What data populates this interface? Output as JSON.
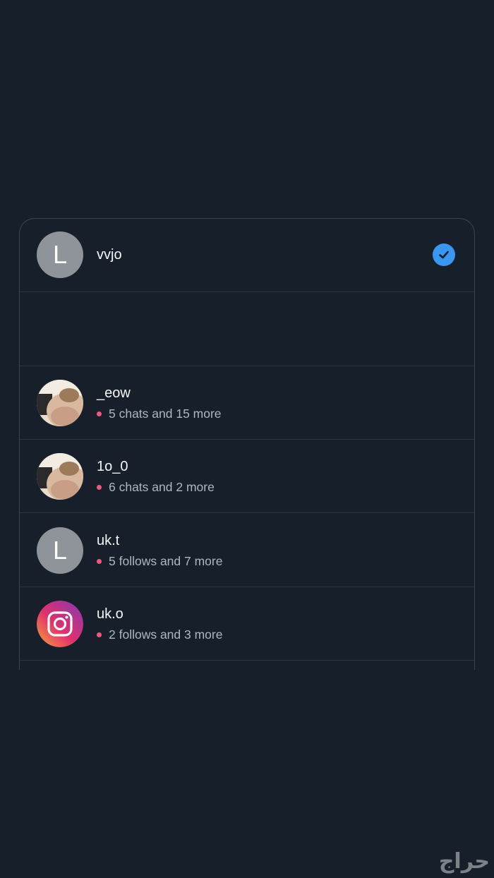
{
  "accounts": [
    {
      "username": "vvjo",
      "avatar_letter": "L",
      "selected": true,
      "subtitle": ""
    },
    {
      "username": "_eow",
      "avatar_type": "photo",
      "subtitle": "5 chats and 15 more"
    },
    {
      "username": "1o_0",
      "avatar_type": "photo",
      "subtitle": "6 chats and 2 more"
    },
    {
      "username": "uk.t",
      "avatar_letter": "L",
      "subtitle": "5 follows and 7 more"
    },
    {
      "username": "uk.o",
      "avatar_type": "instagram-logo",
      "subtitle": "2 follows and 3 more"
    }
  ],
  "colors": {
    "background": "#17202a",
    "check": "#3897f0",
    "notification_dot": "#f4587c"
  },
  "watermark": "حراج"
}
